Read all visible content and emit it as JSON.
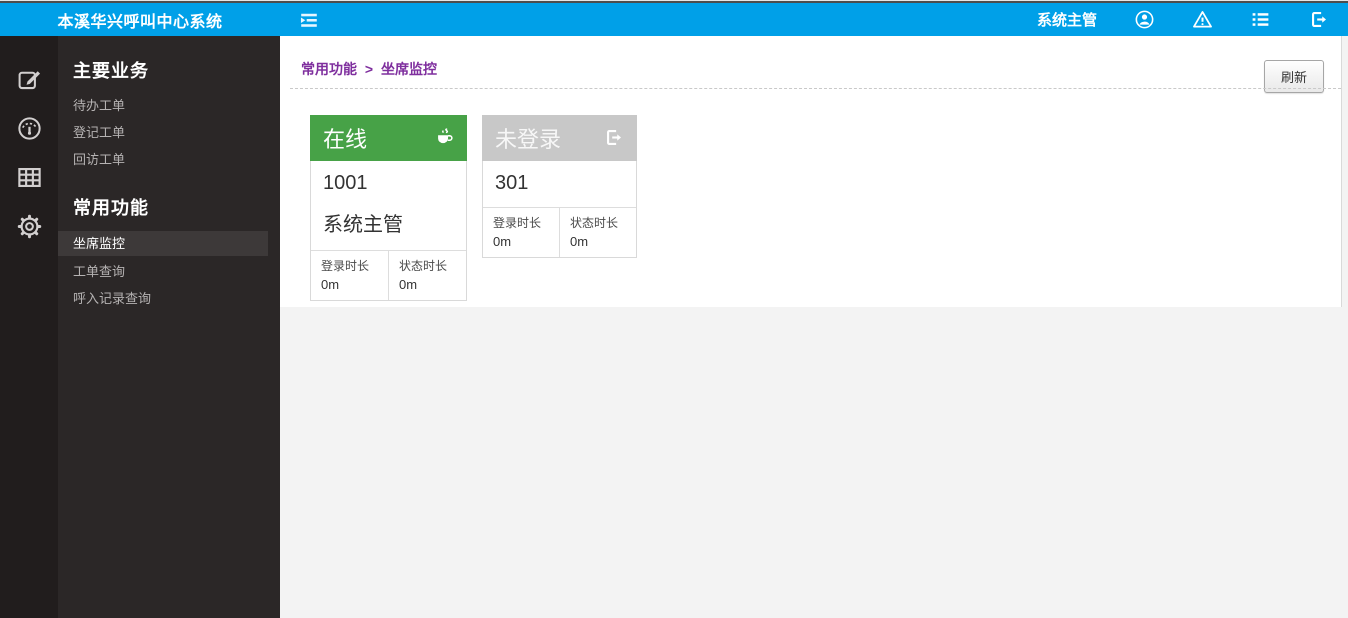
{
  "topbar": {
    "title": "本溪华兴呼叫中心系统",
    "user_label": "系统主管"
  },
  "sidebar": {
    "sections": [
      {
        "header": "主要业务",
        "items": [
          {
            "label": "待办工单"
          },
          {
            "label": "登记工单"
          },
          {
            "label": "回访工单"
          }
        ]
      },
      {
        "header": "常用功能",
        "items": [
          {
            "label": "坐席监控",
            "active": true
          },
          {
            "label": "工单查询"
          },
          {
            "label": "呼入记录查询"
          }
        ]
      }
    ]
  },
  "main": {
    "breadcrumb": {
      "parent": "常用功能",
      "separator": ">",
      "current": "坐席监控"
    },
    "refresh_button": "刷新",
    "cards": [
      {
        "status": "在线",
        "icon": "coffee-cup-icon",
        "agent_id": "1001",
        "agent_name": "系统主管",
        "login_label": "登录时长",
        "login_value": "0m",
        "state_label": "状态时长",
        "state_value": "0m"
      },
      {
        "status": "未登录",
        "icon": "logout-icon",
        "agent_id": "301",
        "login_label": "登录时长",
        "login_value": "0m",
        "state_label": "状态时长",
        "state_value": "0m"
      }
    ]
  },
  "icons": {
    "topbar": [
      "collapse-menu-icon",
      "user-circle-icon",
      "warning-icon",
      "list-icon",
      "logout-icon"
    ],
    "sidebar_strip": [
      "edit-icon",
      "gauge-icon",
      "table-icon",
      "gear-icon"
    ]
  },
  "colors": {
    "topbar_blue": "#00a0e8",
    "online_green": "#47a247",
    "offline_gray": "#c8c8c8",
    "breadcrumb_purple": "#7f2f9e",
    "sidebar_strip_bg": "#211d1d",
    "sidebar_menu_bg": "#2b2727",
    "sidebar_active_bg": "#3d3939",
    "page_bg": "#f3f3f3"
  }
}
